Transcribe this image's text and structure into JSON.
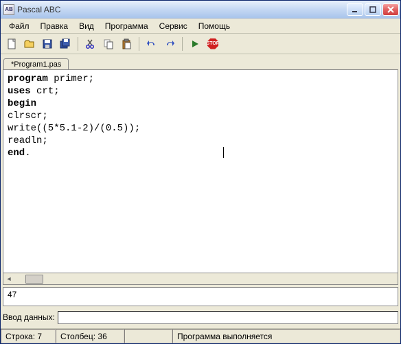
{
  "window": {
    "title": "Pascal ABC",
    "app_icon_text": "AB"
  },
  "menubar": {
    "items": [
      "Файл",
      "Правка",
      "Вид",
      "Программа",
      "Сервис",
      "Помощь"
    ]
  },
  "tabs": {
    "active": "*Program1.pas"
  },
  "editor": {
    "lines": [
      {
        "kw": "program",
        "rest": " primer;"
      },
      {
        "kw": "uses",
        "rest": " crt;"
      },
      {
        "kw": "begin",
        "rest": ""
      },
      {
        "kw": "",
        "rest": "clrscr;"
      },
      {
        "kw": "",
        "rest": "write((5*5.1-2)/(0.5));"
      },
      {
        "kw": "",
        "rest": "readln;"
      },
      {
        "kw": "end",
        "rest": "."
      }
    ]
  },
  "output": "47",
  "input": {
    "label": "Ввод данных:"
  },
  "status": {
    "line_label": "Строка:",
    "line_val": "7",
    "col_label": "Столбец:",
    "col_val": "36",
    "message": "Программа выполняется"
  },
  "toolbar_stop": "STOP"
}
